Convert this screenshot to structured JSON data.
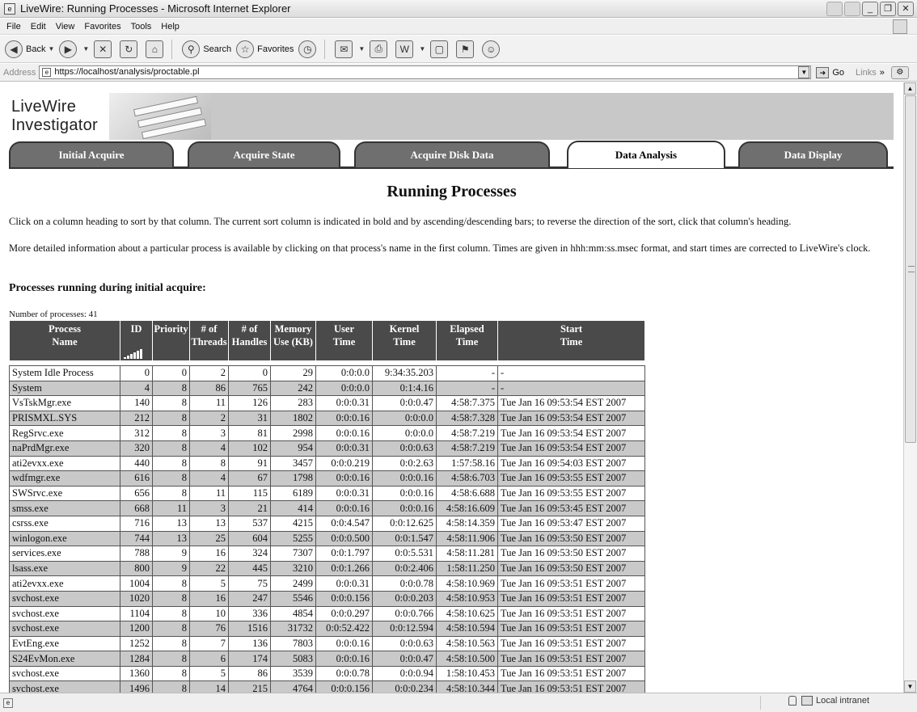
{
  "window": {
    "title": "LiveWire: Running Processes - Microsoft Internet Explorer",
    "app_icon": "ie-page-icon",
    "buttons": [
      "minimize",
      "maximize",
      "close"
    ]
  },
  "menu": [
    "File",
    "Edit",
    "View",
    "Favorites",
    "Tools",
    "Help"
  ],
  "toolbar": {
    "back": "Back",
    "search": "Search",
    "favorites": "Favorites"
  },
  "address": {
    "label": "Address",
    "url": "https://localhost/analysis/proctable.pl",
    "go": "Go",
    "links": "Links"
  },
  "header": {
    "logo_line1": "LiveWire",
    "logo_line2": "Investigator",
    "tabs": [
      {
        "label": "Initial Acquire",
        "active": false
      },
      {
        "label": "Acquire State",
        "active": false
      },
      {
        "label": "Acquire Disk Data",
        "active": false
      },
      {
        "label": "Data Analysis",
        "active": true
      },
      {
        "label": "Data Display",
        "active": false
      }
    ]
  },
  "content": {
    "title": "Running Processes",
    "para1": "Click on a column heading to sort by that column. The current sort column is indicated in bold and by ascending/descending bars; to reverse the direction of the sort, click that column's heading.",
    "para2": "More detailed information about a particular process is available by clicking on that process's name in the first column. Times are given in hhh:mm:ss.msec format, and start times are corrected to LiveWire's clock.",
    "section_heading": "Processes running during initial acquire:",
    "process_count": "Number of processes: 41"
  },
  "table": {
    "headers": [
      {
        "l1": "Process",
        "l2": "Name"
      },
      {
        "l1": "ID",
        "l2": ""
      },
      {
        "l1": "Priority",
        "l2": ""
      },
      {
        "l1": "# of",
        "l2": "Threads"
      },
      {
        "l1": "# of",
        "l2": "Handles"
      },
      {
        "l1": "Memory",
        "l2": "Use (KB)"
      },
      {
        "l1": "User",
        "l2": "Time"
      },
      {
        "l1": "Kernel",
        "l2": "Time"
      },
      {
        "l1": "Elapsed",
        "l2": "Time"
      },
      {
        "l1": "Start",
        "l2": "Time"
      }
    ],
    "rows": [
      [
        "System Idle Process",
        "0",
        "0",
        "2",
        "0",
        "29",
        "0:0:0.0",
        "9:34:35.203",
        "-",
        "-"
      ],
      [
        "System",
        "4",
        "8",
        "86",
        "765",
        "242",
        "0:0:0.0",
        "0:1:4.16",
        "-",
        "-"
      ],
      [
        "VsTskMgr.exe",
        "140",
        "8",
        "11",
        "126",
        "283",
        "0:0:0.31",
        "0:0:0.47",
        "4:58:7.375",
        "Tue Jan 16 09:53:54 EST 2007"
      ],
      [
        "PRISMXL.SYS",
        "212",
        "8",
        "2",
        "31",
        "1802",
        "0:0:0.16",
        "0:0:0.0",
        "4:58:7.328",
        "Tue Jan 16 09:53:54 EST 2007"
      ],
      [
        "RegSrvc.exe",
        "312",
        "8",
        "3",
        "81",
        "2998",
        "0:0:0.16",
        "0:0:0.0",
        "4:58:7.219",
        "Tue Jan 16 09:53:54 EST 2007"
      ],
      [
        "naPrdMgr.exe",
        "320",
        "8",
        "4",
        "102",
        "954",
        "0:0:0.31",
        "0:0:0.63",
        "4:58:7.219",
        "Tue Jan 16 09:53:54 EST 2007"
      ],
      [
        "ati2evxx.exe",
        "440",
        "8",
        "8",
        "91",
        "3457",
        "0:0:0.219",
        "0:0:2.63",
        "1:57:58.16",
        "Tue Jan 16 09:54:03 EST 2007"
      ],
      [
        "wdfmgr.exe",
        "616",
        "8",
        "4",
        "67",
        "1798",
        "0:0:0.16",
        "0:0:0.16",
        "4:58:6.703",
        "Tue Jan 16 09:53:55 EST 2007"
      ],
      [
        "SWSrvc.exe",
        "656",
        "8",
        "11",
        "115",
        "6189",
        "0:0:0.31",
        "0:0:0.16",
        "4:58:6.688",
        "Tue Jan 16 09:53:55 EST 2007"
      ],
      [
        "smss.exe",
        "668",
        "11",
        "3",
        "21",
        "414",
        "0:0:0.16",
        "0:0:0.16",
        "4:58:16.609",
        "Tue Jan 16 09:53:45 EST 2007"
      ],
      [
        "csrss.exe",
        "716",
        "13",
        "13",
        "537",
        "4215",
        "0:0:4.547",
        "0:0:12.625",
        "4:58:14.359",
        "Tue Jan 16 09:53:47 EST 2007"
      ],
      [
        "winlogon.exe",
        "744",
        "13",
        "25",
        "604",
        "5255",
        "0:0:0.500",
        "0:0:1.547",
        "4:58:11.906",
        "Tue Jan 16 09:53:50 EST 2007"
      ],
      [
        "services.exe",
        "788",
        "9",
        "16",
        "324",
        "7307",
        "0:0:1.797",
        "0:0:5.531",
        "4:58:11.281",
        "Tue Jan 16 09:53:50 EST 2007"
      ],
      [
        "lsass.exe",
        "800",
        "9",
        "22",
        "445",
        "3210",
        "0:0:1.266",
        "0:0:2.406",
        "1:58:11.250",
        "Tue Jan 16 09:53:50 EST 2007"
      ],
      [
        "ati2evxx.exe",
        "1004",
        "8",
        "5",
        "75",
        "2499",
        "0:0:0.31",
        "0:0:0.78",
        "4:58:10.969",
        "Tue Jan 16 09:53:51 EST 2007"
      ],
      [
        "svchost.exe",
        "1020",
        "8",
        "16",
        "247",
        "5546",
        "0:0:0.156",
        "0:0:0.203",
        "4:58:10.953",
        "Tue Jan 16 09:53:51 EST 2007"
      ],
      [
        "svchost.exe",
        "1104",
        "8",
        "10",
        "336",
        "4854",
        "0:0:0.297",
        "0:0:0.766",
        "4:58:10.625",
        "Tue Jan 16 09:53:51 EST 2007"
      ],
      [
        "svchost.exe",
        "1200",
        "8",
        "76",
        "1516",
        "31732",
        "0:0:52.422",
        "0:0:12.594",
        "4:58:10.594",
        "Tue Jan 16 09:53:51 EST 2007"
      ],
      [
        "EvtEng.exe",
        "1252",
        "8",
        "7",
        "136",
        "7803",
        "0:0:0.16",
        "0:0:0.63",
        "4:58:10.563",
        "Tue Jan 16 09:53:51 EST 2007"
      ],
      [
        "S24EvMon.exe",
        "1284",
        "8",
        "6",
        "174",
        "5083",
        "0:0:0.16",
        "0:0:0.47",
        "4:58:10.500",
        "Tue Jan 16 09:53:51 EST 2007"
      ],
      [
        "svchost.exe",
        "1360",
        "8",
        "5",
        "86",
        "3539",
        "0:0:0.78",
        "0:0:0.94",
        "1:58:10.453",
        "Tue Jan 16 09:53:51 EST 2007"
      ],
      [
        "svchost.exe",
        "1496",
        "8",
        "14",
        "215",
        "4764",
        "0:0:0.156",
        "0:0:0.234",
        "4:58:10.344",
        "Tue Jan 16 09:53:51 EST 2007"
      ]
    ]
  },
  "status": {
    "zone": "Local intranet"
  }
}
